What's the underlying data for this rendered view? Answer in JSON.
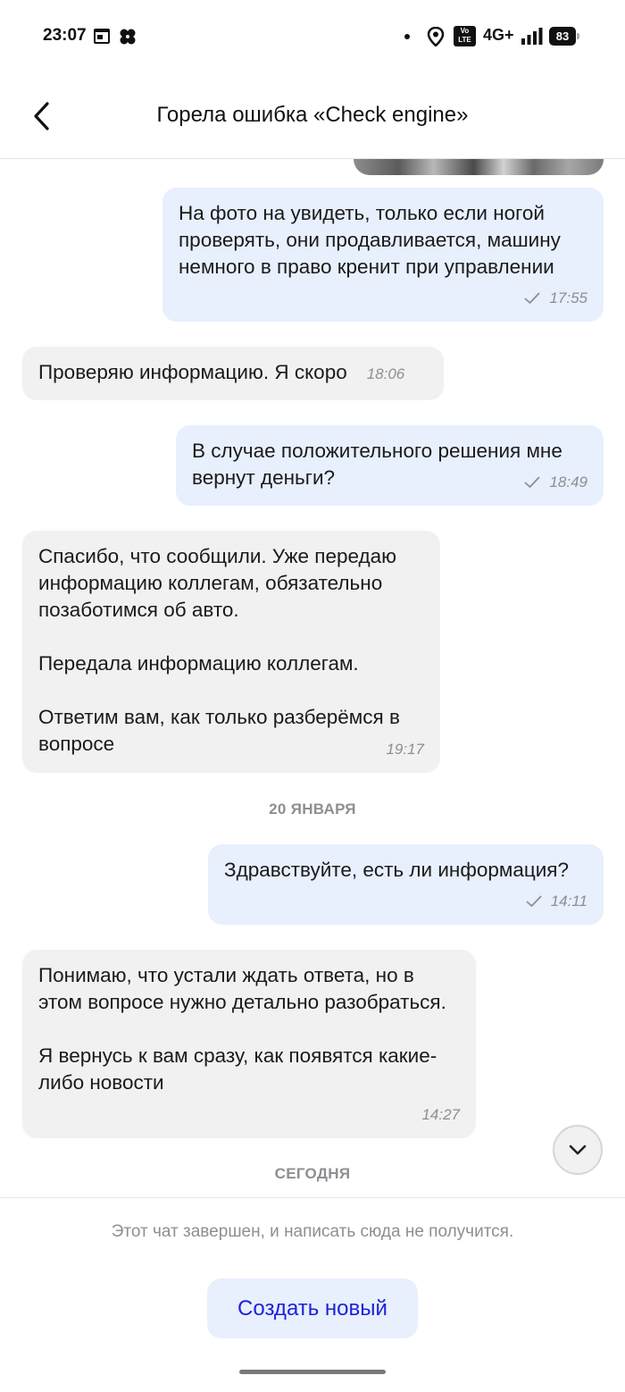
{
  "status_bar": {
    "time": "23:07",
    "volte": "Vo\nLTE",
    "network": "4G+",
    "battery": "83",
    "icons": [
      "calendar-icon",
      "fan-icon",
      "dot-icon",
      "location-icon",
      "volte-icon",
      "signal-icon",
      "battery-icon"
    ]
  },
  "header": {
    "title": "Горела ошибка «Check engine»",
    "back_icon": "chevron-left-icon"
  },
  "messages": [
    {
      "direction": "out",
      "text": "На фото на увидеть, только если ногой проверять, они продавливается, машину немного в право кренит при управлении",
      "time": "17:55",
      "status": "sent"
    },
    {
      "direction": "in",
      "text": "Проверяю информацию. Я скоро",
      "time": "18:06"
    },
    {
      "direction": "out",
      "text": "В случае положительного решения мне вернут деньги?",
      "time": "18:49",
      "status": "sent"
    },
    {
      "direction": "in",
      "text": "Спасибо, что сообщили. Уже передаю информацию коллегам, обязательно позаботимся об авто.\n\nПередала информацию коллегам.\n\nОтветим вам, как только разберёмся в вопросе",
      "time": "19:17"
    },
    {
      "direction": "out",
      "text": "Здравствуйте, есть ли информация?",
      "time": "14:11",
      "status": "sent"
    },
    {
      "direction": "in",
      "text": "Понимаю, что устали ждать ответа, но в этом вопросе нужно детально разобраться.\n\nЯ вернусь к вам сразу, как появятся какие-либо новости",
      "time": "14:27"
    }
  ],
  "date_separators": [
    "20 ЯНВАРЯ",
    "СЕГОДНЯ"
  ],
  "footer": {
    "closed_note": "Этот чат завершен, и написать сюда не получится.",
    "create_button": "Создать новый"
  },
  "colors": {
    "outgoing_bubble": "#e8effd",
    "incoming_bubble": "#f1f1f1",
    "accent": "#1c23d8",
    "meta_text": "#8e8e93"
  }
}
